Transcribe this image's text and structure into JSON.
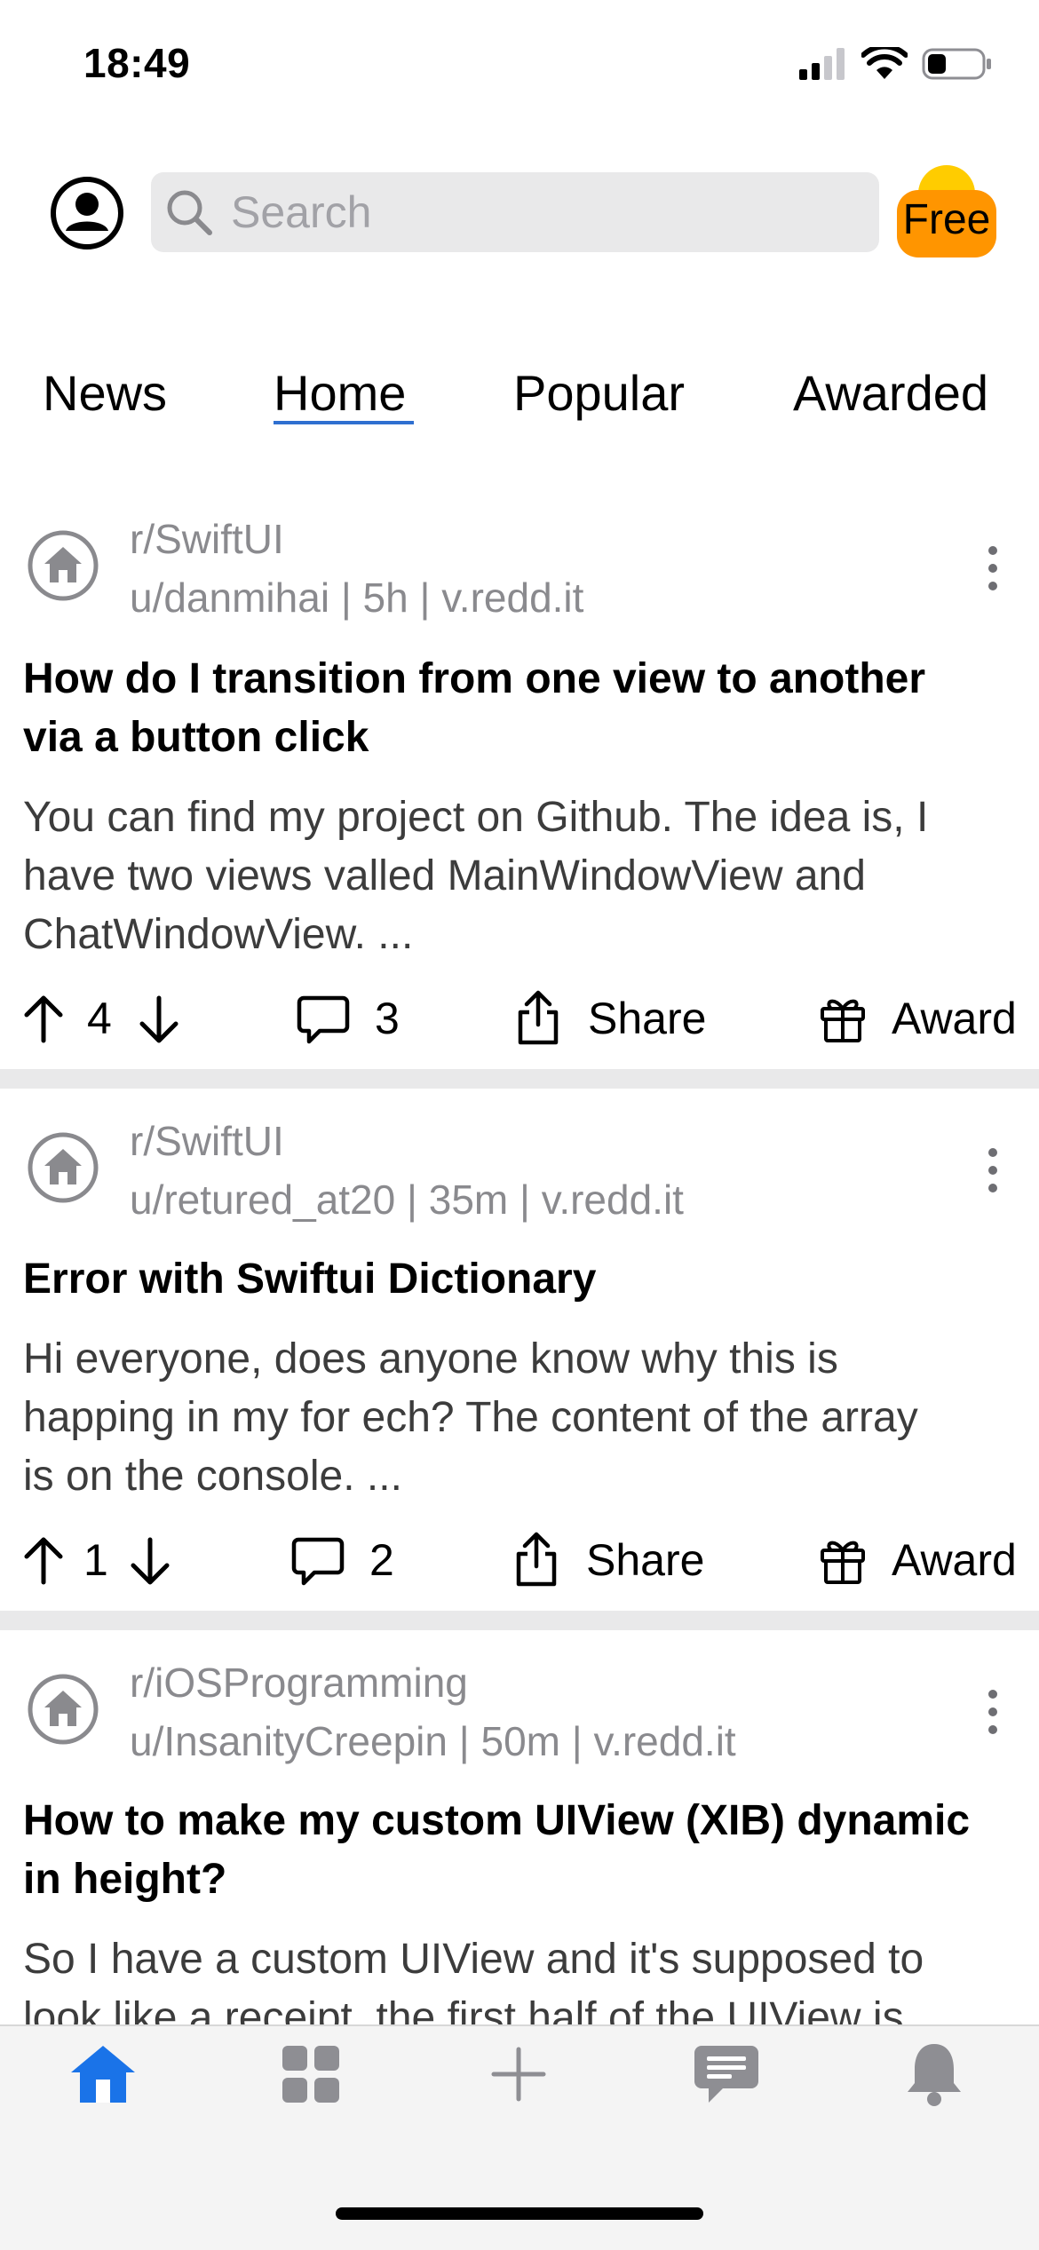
{
  "status_bar": {
    "time": "18:49"
  },
  "header": {
    "search_placeholder": "Search",
    "free_badge": "Free"
  },
  "tabs": [
    {
      "label": "News"
    },
    {
      "label": "Home"
    },
    {
      "label": "Popular"
    },
    {
      "label": "Awarded"
    }
  ],
  "selected_tab": "Home",
  "posts": [
    {
      "subreddit": "r/SwiftUI",
      "meta": "u/danmihai | 5h | v.redd.it",
      "title_line1": "How do I transition from one view to another",
      "title_line2": "via a button click",
      "body_line1": "You can find my project on Github. The idea is, I",
      "body_line2": "have two views valled MainWindowView and",
      "body_line3": "ChatWindowView. ...",
      "votes": "4",
      "comments": "3",
      "share": "Share",
      "award": "Award"
    },
    {
      "subreddit": "r/SwiftUI",
      "meta": "u/retured_at20 | 35m | v.redd.it",
      "title_line1": "Error with Swiftui Dictionary",
      "body_line1": "Hi everyone, does anyone know why this is",
      "body_line2": "happing in my for ech? The content of the array",
      "body_line3": "is on the console. ...",
      "votes": "1",
      "comments": "2",
      "share": "Share",
      "award": "Award"
    },
    {
      "subreddit": "r/iOSProgramming",
      "meta": "u/InsanityCreepin | 50m | v.redd.it",
      "title_line1": "How to make my custom UIView (XIB) dynamic",
      "title_line2": "in height?",
      "body_line1": "So I have a custom UIView and it's supposed to",
      "body_line2": "look like a receipt, the first half of the UIView is"
    }
  ],
  "tab_bar": {
    "items": [
      "house-icon",
      "grid-icon",
      "plus-icon",
      "chat-icon",
      "bell-icon"
    ],
    "active_color": "#1a73e8",
    "inactive_color": "#8e8e93"
  }
}
